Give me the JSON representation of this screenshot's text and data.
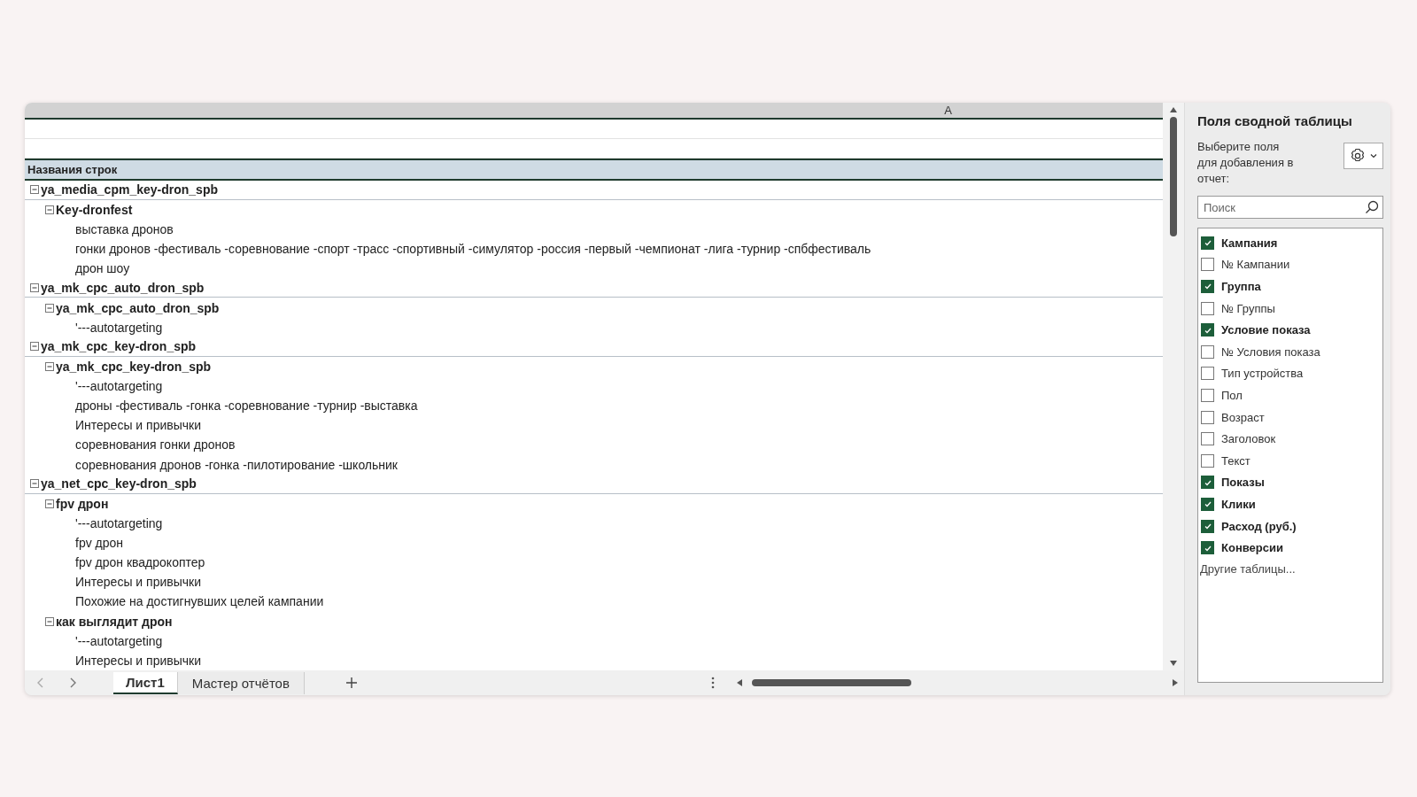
{
  "sheet": {
    "column_header": "A",
    "header_row": "Названия строк",
    "tree": [
      {
        "label": "ya_media_cpm_key-dron_spb",
        "expanded": true,
        "children": [
          {
            "label": "Key-dronfest",
            "expanded": true,
            "children": [
              {
                "label": "выставка дронов"
              },
              {
                "label": "гонки дронов -фестиваль -соревнование -спорт -трасс -спортивный -симулятор -россия -первый -чемпионат -лига -турнир -спбфестиваль"
              },
              {
                "label": "дрон шоу"
              }
            ]
          }
        ]
      },
      {
        "label": "ya_mk_cpc_auto_dron_spb",
        "expanded": true,
        "children": [
          {
            "label": "ya_mk_cpc_auto_dron_spb",
            "expanded": true,
            "children": [
              {
                "label": "'---autotargeting"
              }
            ]
          }
        ]
      },
      {
        "label": "ya_mk_cpc_key-dron_spb",
        "expanded": true,
        "children": [
          {
            "label": "ya_mk_cpc_key-dron_spb",
            "expanded": true,
            "children": [
              {
                "label": "'---autotargeting"
              },
              {
                "label": "дроны -фестиваль -гонка -соревнование -турнир -выставка"
              },
              {
                "label": "Интересы и привычки"
              },
              {
                "label": "соревнования гонки дронов"
              },
              {
                "label": "соревнования дронов -гонка -пилотирование -школьник"
              }
            ]
          }
        ]
      },
      {
        "label": "ya_net_cpc_key-dron_spb",
        "expanded": true,
        "children": [
          {
            "label": "fpv дрон",
            "expanded": true,
            "children": [
              {
                "label": "'---autotargeting"
              },
              {
                "label": "fpv дрон"
              },
              {
                "label": "fpv дрон квадрокоптер"
              },
              {
                "label": "Интересы и привычки"
              },
              {
                "label": "Похожие на достигнувших целей кампании"
              }
            ]
          },
          {
            "label": "как выглядит дрон",
            "expanded": true,
            "children": [
              {
                "label": "'---autotargeting"
              },
              {
                "label": "Интересы и привычки"
              }
            ]
          }
        ]
      }
    ]
  },
  "sheet_tabs": [
    {
      "label": "Лист1",
      "selected": true
    },
    {
      "label": "Мастер отчётов",
      "selected": false
    }
  ],
  "pivot_pane": {
    "title": "Поля сводной таблицы",
    "instruction": "Выберите поля для добавления в отчет:",
    "search": {
      "placeholder": "Поиск"
    },
    "fields": [
      {
        "label": "Кампания",
        "checked": true
      },
      {
        "label": "№ Кампании",
        "checked": false
      },
      {
        "label": "Группа",
        "checked": true
      },
      {
        "label": "№ Группы",
        "checked": false
      },
      {
        "label": "Условие показа",
        "checked": true
      },
      {
        "label": "№ Условия показа",
        "checked": false
      },
      {
        "label": "Тип устройства",
        "checked": false
      },
      {
        "label": "Пол",
        "checked": false
      },
      {
        "label": "Возраст",
        "checked": false
      },
      {
        "label": "Заголовок",
        "checked": false
      },
      {
        "label": "Текст",
        "checked": false
      },
      {
        "label": "Показы",
        "checked": true
      },
      {
        "label": "Клики",
        "checked": true
      },
      {
        "label": "Расход (руб.)",
        "checked": true
      },
      {
        "label": "Конверсии",
        "checked": true
      }
    ],
    "more_link": "Другие таблицы..."
  }
}
